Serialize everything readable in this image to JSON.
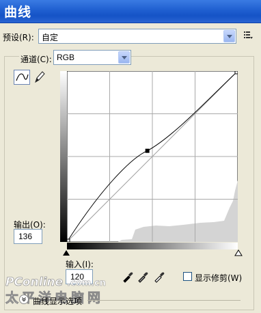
{
  "window": {
    "title": "曲线"
  },
  "preset": {
    "label": "预设(R):",
    "value": "自定"
  },
  "channel": {
    "label": "通道(C):",
    "value": "RGB"
  },
  "output": {
    "label": "输出(O):",
    "value": "136"
  },
  "input": {
    "label": "输入(I):",
    "value": "120"
  },
  "show_clipping": {
    "label": "显示修剪(W)",
    "checked": false
  },
  "curve_display_options": {
    "label": "曲线显示选项"
  },
  "watermark": {
    "text": "PConline.com.cn 太平洋电脑网"
  },
  "curve": {
    "control_point": {
      "input": 120,
      "output": 136
    },
    "line_color": "#000000",
    "baseline_color": "#a0a0a0"
  },
  "histogram_color": "#d4d4d4",
  "colors": {
    "title_bar": "#1f5fd0",
    "dialog_bg": "#ece9d8",
    "field_border": "#7f9db9"
  }
}
